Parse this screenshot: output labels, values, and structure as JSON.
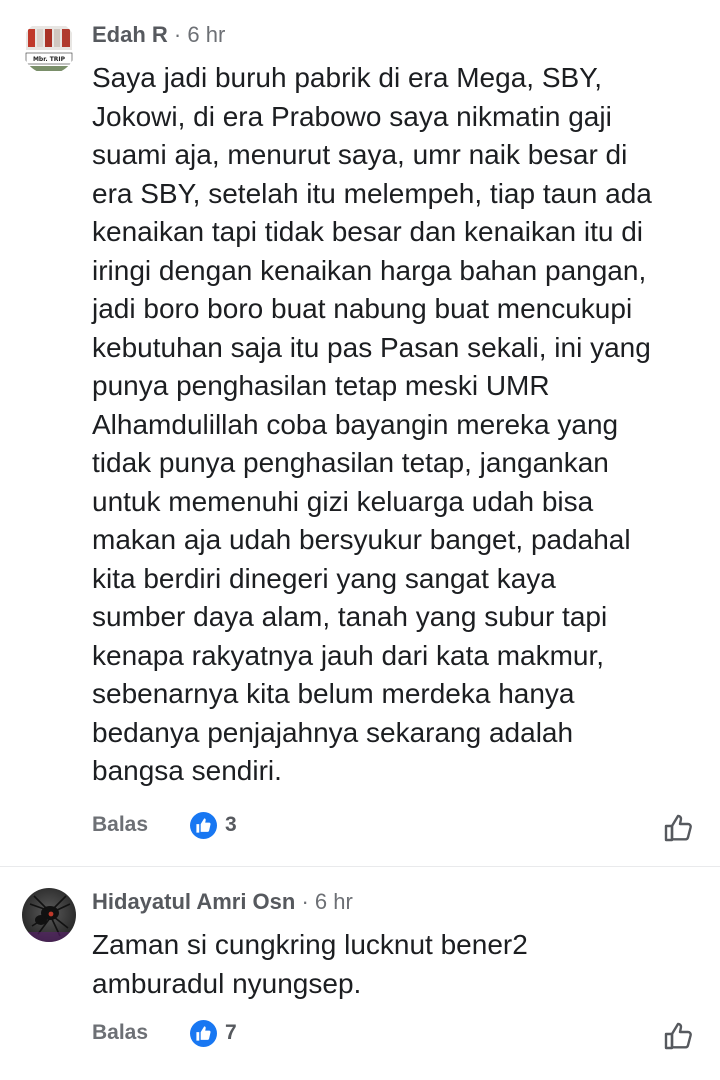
{
  "comments": [
    {
      "author": "Edah R",
      "separator": "·",
      "time": "6 hr",
      "avatar_text": "Mbr. TRIP",
      "text": "Saya jadi buruh pabrik di era Mega, SBY,\nJokowi, di era Prabowo saya nikmatin gaji\nsuami aja, menurut saya, umr naik besar di\nera SBY, setelah itu melempeh, tiap taun ada\nkenaikan tapi tidak besar dan kenaikan itu di\niringi dengan kenaikan harga bahan pangan,\njadi boro boro buat nabung buat mencukupi\nkebutuhan saja itu pas Pasan sekali, ini yang\npunya penghasilan tetap meski UMR\nAlhamdulillah coba bayangin mereka yang\ntidak punya penghasilan tetap,  jangankan\nuntuk memenuhi gizi keluarga udah bisa\nmakan aja udah bersyukur banget, padahal\nkita berdiri dinegeri yang sangat kaya\nsumber daya alam, tanah yang subur tapi\nkenapa rakyatnya jauh dari kata makmur,\nsebenarnya kita belum merdeka hanya\nbedanya penjajahnya sekarang adalah\nbangsa sendiri.",
      "reply_label": "Balas",
      "reaction_icon": "like-badge-icon",
      "reaction_count": "3"
    },
    {
      "author": "Hidayatul Amri Osn",
      "separator": "·",
      "time": "6 hr",
      "text": "Zaman si cungkring lucknut bener2\namburadul nyungsep.",
      "reply_label": "Balas",
      "reaction_icon": "like-badge-icon",
      "reaction_count": "7"
    }
  ],
  "colors": {
    "like_blue": "#1877f2",
    "text_primary": "#1c1e21",
    "text_secondary": "#6d7075",
    "divider": "#e9eaec"
  }
}
